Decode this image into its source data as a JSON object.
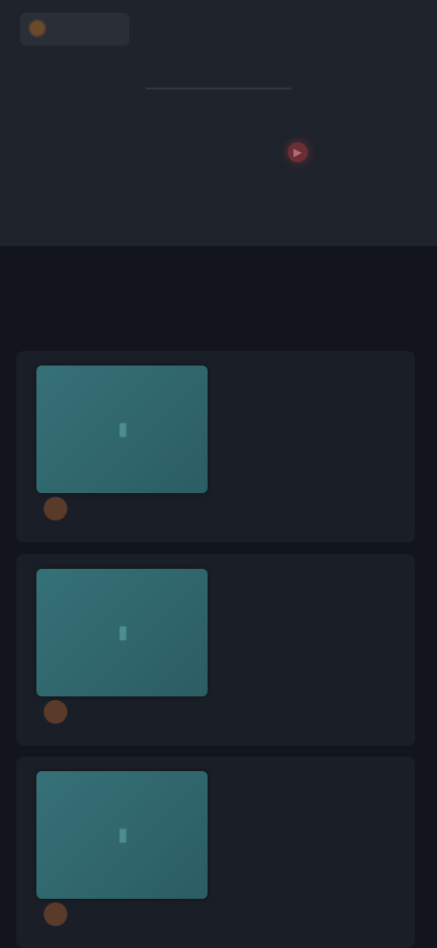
{
  "app": {
    "logo_text": "",
    "nav_left": "",
    "nav_tab": ""
  },
  "header": {
    "title": "",
    "subtitle": "",
    "action_label": ""
  },
  "section": {
    "label": ""
  },
  "cards": [
    {
      "title": "",
      "author": "",
      "meta": ""
    },
    {
      "title": "",
      "author": "",
      "meta": ""
    },
    {
      "title": "",
      "author": "",
      "meta": ""
    }
  ],
  "colors": {
    "page_bg": "#14171f",
    "header_bg": "#1f232c",
    "card_bg": "#1a1e26",
    "thumb_teal": "#357177",
    "accent_red": "#6a2f36"
  }
}
